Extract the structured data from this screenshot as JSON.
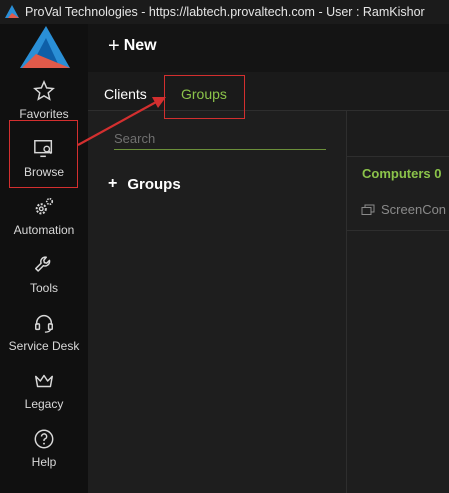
{
  "window": {
    "title": "ProVal Technologies - https://labtech.provaltech.com - User : RamKishor"
  },
  "colors": {
    "accent": "#8bc34a",
    "highlight": "#d32f2f",
    "logo_blue": "#2a8fd6",
    "logo_red": "#e05a4a"
  },
  "topbar": {
    "new_label": "New"
  },
  "sidebar": {
    "items": [
      {
        "label": "Favorites",
        "icon": "star-icon"
      },
      {
        "label": "Browse",
        "icon": "browse-monitor-icon"
      },
      {
        "label": "Automation",
        "icon": "gears-icon"
      },
      {
        "label": "Tools",
        "icon": "wrench-icon"
      },
      {
        "label": "Service Desk",
        "icon": "headset-icon"
      },
      {
        "label": "Legacy",
        "icon": "crown-icon"
      },
      {
        "label": "Help",
        "icon": "help-icon"
      }
    ]
  },
  "tabs": [
    {
      "label": "Clients"
    },
    {
      "label": "Groups"
    }
  ],
  "search": {
    "placeholder": "Search",
    "value": ""
  },
  "tree": {
    "groups_label": "Groups"
  },
  "right": {
    "computers_label": "Computers 0",
    "screencon_label": "ScreenCon"
  }
}
